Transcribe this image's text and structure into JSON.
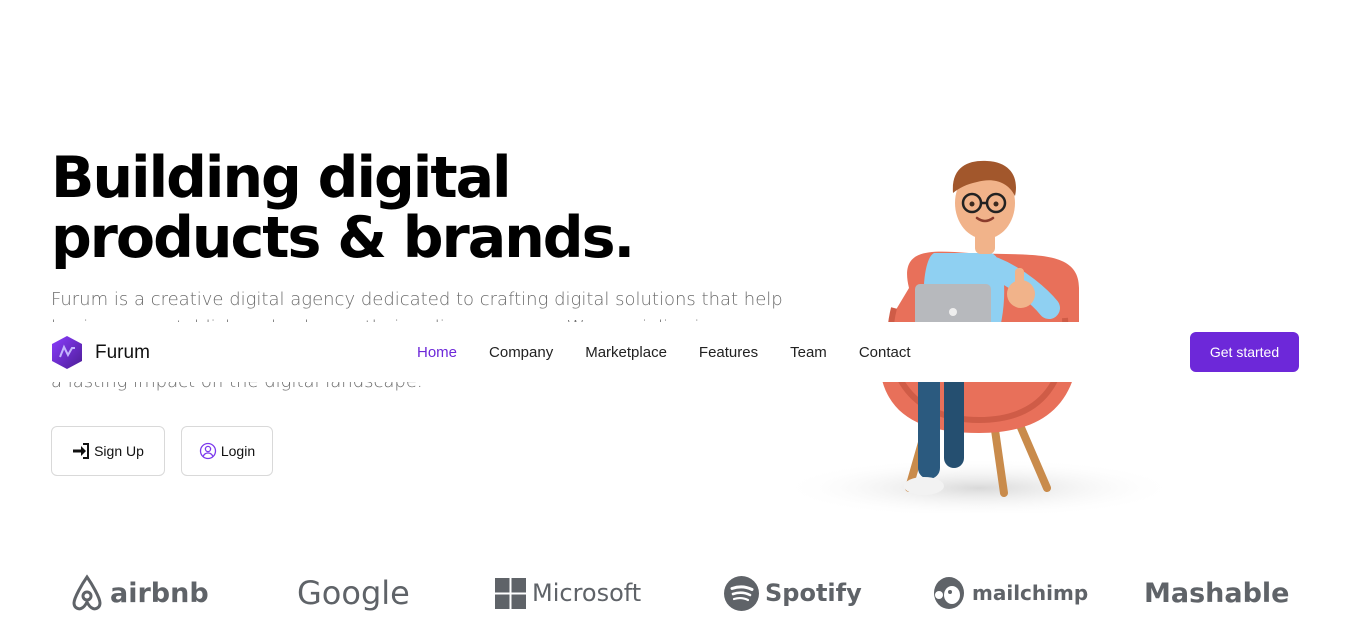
{
  "hero": {
    "title_line1": "Building digital",
    "title_line2": "products & brands.",
    "desc_line1": "Furum is a creative digital agency dedicated to crafting digital solutions that help",
    "desc_line2": "businesses establish and enhance their online presence. We specialize in",
    "desc_line3": "a lasting impact on the digital landscape."
  },
  "actions": {
    "signup_label": "Sign Up",
    "login_label": "Login"
  },
  "nav": {
    "brand": "Furum",
    "links": [
      "Home",
      "Company",
      "Marketplace",
      "Features",
      "Team",
      "Contact"
    ],
    "active": "Home",
    "cta_label": "Get started"
  },
  "partners": {
    "logos": [
      "airbnb",
      "Google",
      "Microsoft",
      "Spotify",
      "mailchimp",
      "Mashable"
    ]
  },
  "colors": {
    "accent": "#6d28d9",
    "logo_gray": "#5f6368",
    "chair": "#e8705a",
    "shirt": "#8fd0f2"
  }
}
